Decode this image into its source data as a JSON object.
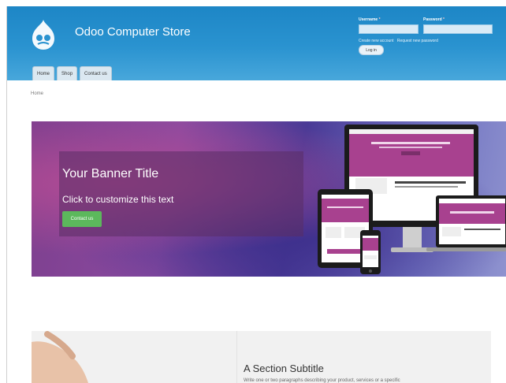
{
  "header": {
    "site_name": "Odoo Computer Store",
    "login": {
      "username_label": "Username",
      "password_label": "Password",
      "required_mark": "*",
      "create_account": "Create new account",
      "request_password": "Request new password",
      "login_button": "Log in"
    }
  },
  "tabs": [
    "Home",
    "Shop",
    "Contact us"
  ],
  "breadcrumb": "Home",
  "banner": {
    "title": "Your Banner Title",
    "text": "Click to customize this text",
    "button": "Contact us"
  },
  "section": {
    "subtitle": "A Section Subtitle",
    "text": "Write one or two paragraphs describing your product, services or a specific"
  },
  "colors": {
    "header_blue": "#2a93d0",
    "button_green": "#5cb85c",
    "banner_purple": "#8a4aa0"
  }
}
